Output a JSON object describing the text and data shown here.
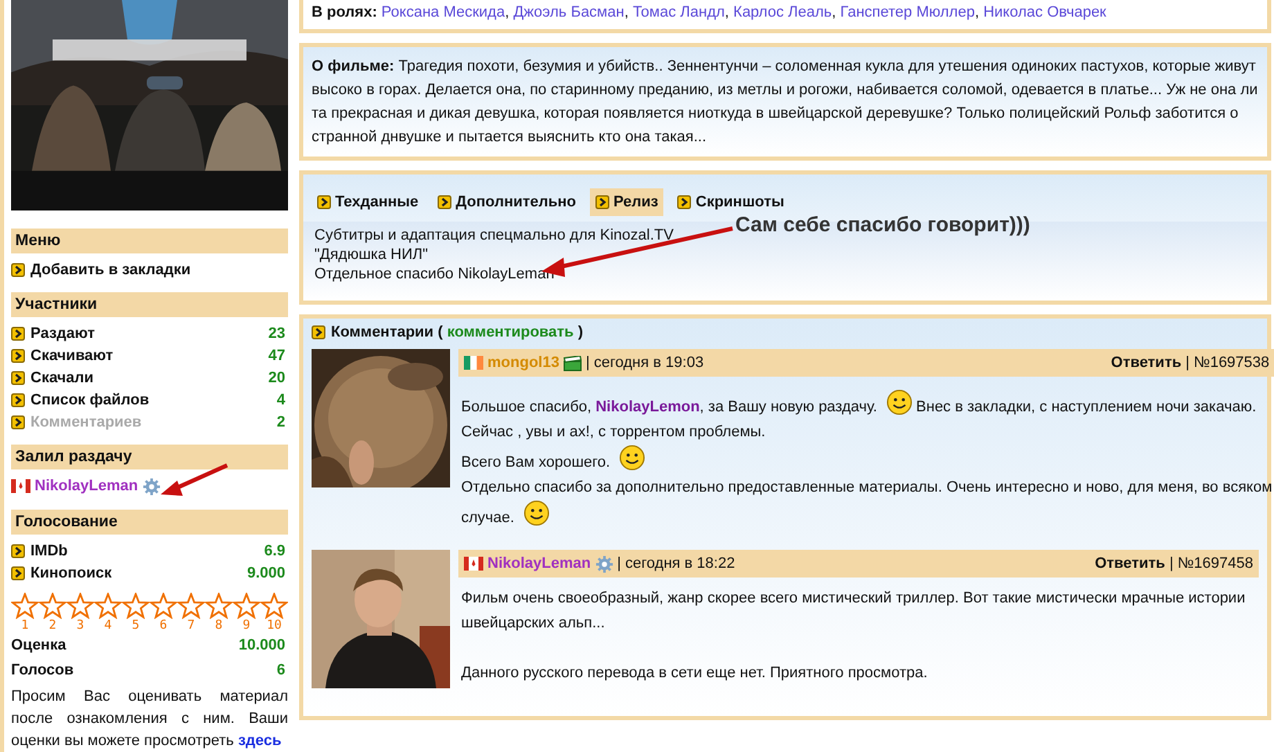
{
  "sidebar": [
    {
      "kind": "links",
      "title": "Меню",
      "items": [
        {
          "label": "Добавить в закладки"
        }
      ]
    },
    {
      "kind": "stats",
      "title": "Участники",
      "items": [
        {
          "label": "Раздают",
          "value": "23",
          "disabled": false
        },
        {
          "label": "Скачивают",
          "value": "47",
          "disabled": false
        },
        {
          "label": "Скачали",
          "value": "20",
          "disabled": false
        },
        {
          "label": "Список файлов",
          "value": "4",
          "disabled": false
        },
        {
          "label": "Комментариев",
          "value": "2",
          "disabled": true
        }
      ]
    },
    {
      "kind": "user",
      "title": "Залил раздачу",
      "user": "NikolayLeman"
    },
    {
      "kind": "voting",
      "title": "Голосование",
      "items": [
        {
          "label": "IMDb",
          "value": "6.9"
        },
        {
          "label": "Кинопоиск",
          "value": "9.000"
        }
      ],
      "stars": 0,
      "star_labels": [
        "1",
        "2",
        "3",
        "4",
        "5",
        "6",
        "7",
        "8",
        "9",
        "10"
      ],
      "totals": [
        {
          "label": "Оценка",
          "value": "10.000"
        },
        {
          "label": "Голосов",
          "value": "6"
        }
      ],
      "note": "Просим Вас оценивать материал после ознакомления с ним. Ваши оценки вы можете просмотреть ",
      "note_link": "здесь"
    }
  ],
  "cast": {
    "label": "В ролях:",
    "separator": ",",
    "names": [
      "Роксана Мескида",
      "Джоэль Басман",
      "Томас Ландл",
      "Карлос Леаль",
      "Ганспетер Мюллер",
      "Николас Овчарек"
    ]
  },
  "about": {
    "label": "О фильме:",
    "text": "Трагедия похоти, безумия и убийств.. Зеннентунчи – соломенная кукла для утешения одиноких пастухов, которые живут высоко в горах. Делается она, по старинному преданию, из метлы и рогожи, набивается соломой, одевается в платье... Уж не она ли та прекрасная и дикая девушка, которая появляется ниоткуда в швейцарской деревушке? Только полицейский Рольф заботится о странной днвушке и пытается выяснить кто она такая..."
  },
  "release": {
    "tabs": [
      {
        "label": "Техданные",
        "selected": false
      },
      {
        "label": "Дополнительно",
        "selected": false
      },
      {
        "label": "Релиз",
        "selected": true
      },
      {
        "label": "Скриншоты",
        "selected": false
      }
    ],
    "lines": [
      "Субтитры и адаптация спецмально для Kinozal.TV",
      "\"Дядюшка НИЛ\"",
      "Отдельное спасибо NikolayLeman"
    ]
  },
  "comments": {
    "title": "Комментарии (",
    "link": "комментировать",
    "title_end": ")",
    "items": [
      {
        "kind": "viewer",
        "author": "mongol13",
        "color": "#d48a00",
        "time": "| сегодня в 19:03",
        "reply": "Ответить",
        "number": "| №1697538",
        "paragraphs": [
          [
            {
              "kind": "text",
              "text": "Большое спасибо, **NikolayLemon**, за Вашу новую раздачу."
            },
            {
              "kind": "smiley"
            },
            {
              "kind": "text",
              "text": "Внес в закладки, с наступлением ночи закачаю."
            },
            {
              "kind": "text",
              "text": "Сейчас , увы и ах!, с торрентом проблемы."
            }
          ],
          [
            {
              "kind": "text",
              "text": "Всего Вам хорошего."
            },
            {
              "kind": "smiley"
            }
          ],
          [
            {
              "kind": "text",
              "text": "Отдельно спасибо за дополнительно предоставленные материалы. Очень интересно и ново, для меня, во всяком"
            },
            {
              "kind": "text",
              "text": "случае."
            },
            {
              "kind": "smiley"
            }
          ]
        ]
      },
      {
        "kind": "uploader",
        "author": "NikolayLeman",
        "color": "#a030c0",
        "time": "| сегодня в 18:22",
        "reply": "Ответить",
        "number": "| №1697458",
        "paragraphs": [
          [
            {
              "kind": "text",
              "text": "Фильм очень своеобразный, жанр скорее всего мистический триллер. Вот такие мистически мрачные истории швейцарских альп..."
            }
          ],
          [
            {
              "kind": "text",
              "text": "Данного русского перевода в сети еще нет. Приятного просмотра."
            }
          ]
        ]
      }
    ]
  },
  "annotation": {
    "text": "Сам себе спасибо говорит)))"
  }
}
